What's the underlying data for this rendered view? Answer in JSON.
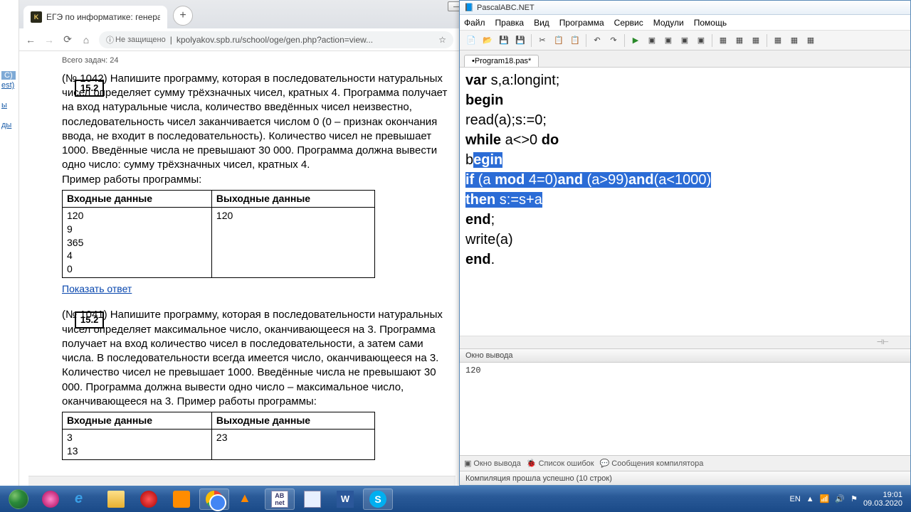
{
  "browser": {
    "tab_title": "ЕГЭ по информатике: генератор",
    "security": "Не защищено",
    "url": "kpolyakov.spb.ru/school/oge/gen.php?action=view...",
    "top_line": "Всего задач: 24",
    "task1": {
      "num": "15.2",
      "id": "(№ 1042)",
      "text": "Напишите программу, которая в последовательности натуральных чисел определяет сумму трёхзначных чисел, кратных 4. Программа получает на вход натуральные числа, количество введённых чисел неизвестно, последовательность чисел заканчивается числом 0 (0 – признак окончания ввода, не входит в последовательность). Количество чисел не превышает 1000. Введённые числа не превышают 30 000. Программа должна вывести одно число: сумму трёхзначных чисел, кратных 4.",
      "example_label": "Пример работы программы:",
      "col1": "Входные данные",
      "col2": "Выходные данные",
      "in": "120\n9\n365\n4\n0",
      "out": "120",
      "answer_link": "Показать ответ"
    },
    "task2": {
      "num": "15.2",
      "id": "(№ 1041)",
      "text": "Напишите программу, которая в последовательности натуральных чисел определяет максимальное число, оканчивающееся на 3. Программа получает на вход количество чисел в последовательности, а затем сами числа. В последовательности всегда имеется число, оканчивающееся на 3. Количество чисел не превышает 1000. Введённые числа не превышают 30 000. Программа должна вывести одно число – максимальное число, оканчивающееся на 3. Пример работы программы:",
      "col1": "Входные данные",
      "col2": "Выходные данные",
      "in": "3\n13",
      "out": "23"
    }
  },
  "ide": {
    "title": "PascalABC.NET",
    "menu": [
      "Файл",
      "Правка",
      "Вид",
      "Программа",
      "Сервис",
      "Модули",
      "Помощь"
    ],
    "tab": "•Program18.pas*",
    "code": {
      "l1a": "var",
      "l1b": " s,a:longint;",
      "l2": "begin",
      "l3": "   read(a);s:=0;",
      "l4a": "   ",
      "l4b": "while",
      "l4c": " a<>0 ",
      "l4d": "do",
      "l5a": "   b",
      "l5b": "egin",
      "l6a": "     ",
      "l6b": "if",
      "l6c": " (a ",
      "l6d": "mod",
      "l6e": " 4=0)",
      "l6f": "and",
      "l6g": " (a>99)",
      "l6h": "and",
      "l6i": "(a<1000)",
      "l7a": "     ",
      "l7b": "then",
      "l7c": " s:=s+a",
      "l8a": "   ",
      "l8b": "end",
      "l8c": ";",
      "l9": "write(a)",
      "l10a": "end",
      "l10b": "."
    },
    "output_header": "Окно вывода",
    "output": "120",
    "bottabs": [
      "Окно вывода",
      "Список ошибок",
      "Сообщения компилятора"
    ],
    "status": "Компиляция прошла успешно (10 строк)"
  },
  "tray": {
    "lang": "EN",
    "time": "19:01",
    "date": "09.03.2020"
  },
  "sidebar": {
    "s1": "C)",
    "s2": "est)",
    "s3": "ы",
    "s4": "ды"
  }
}
